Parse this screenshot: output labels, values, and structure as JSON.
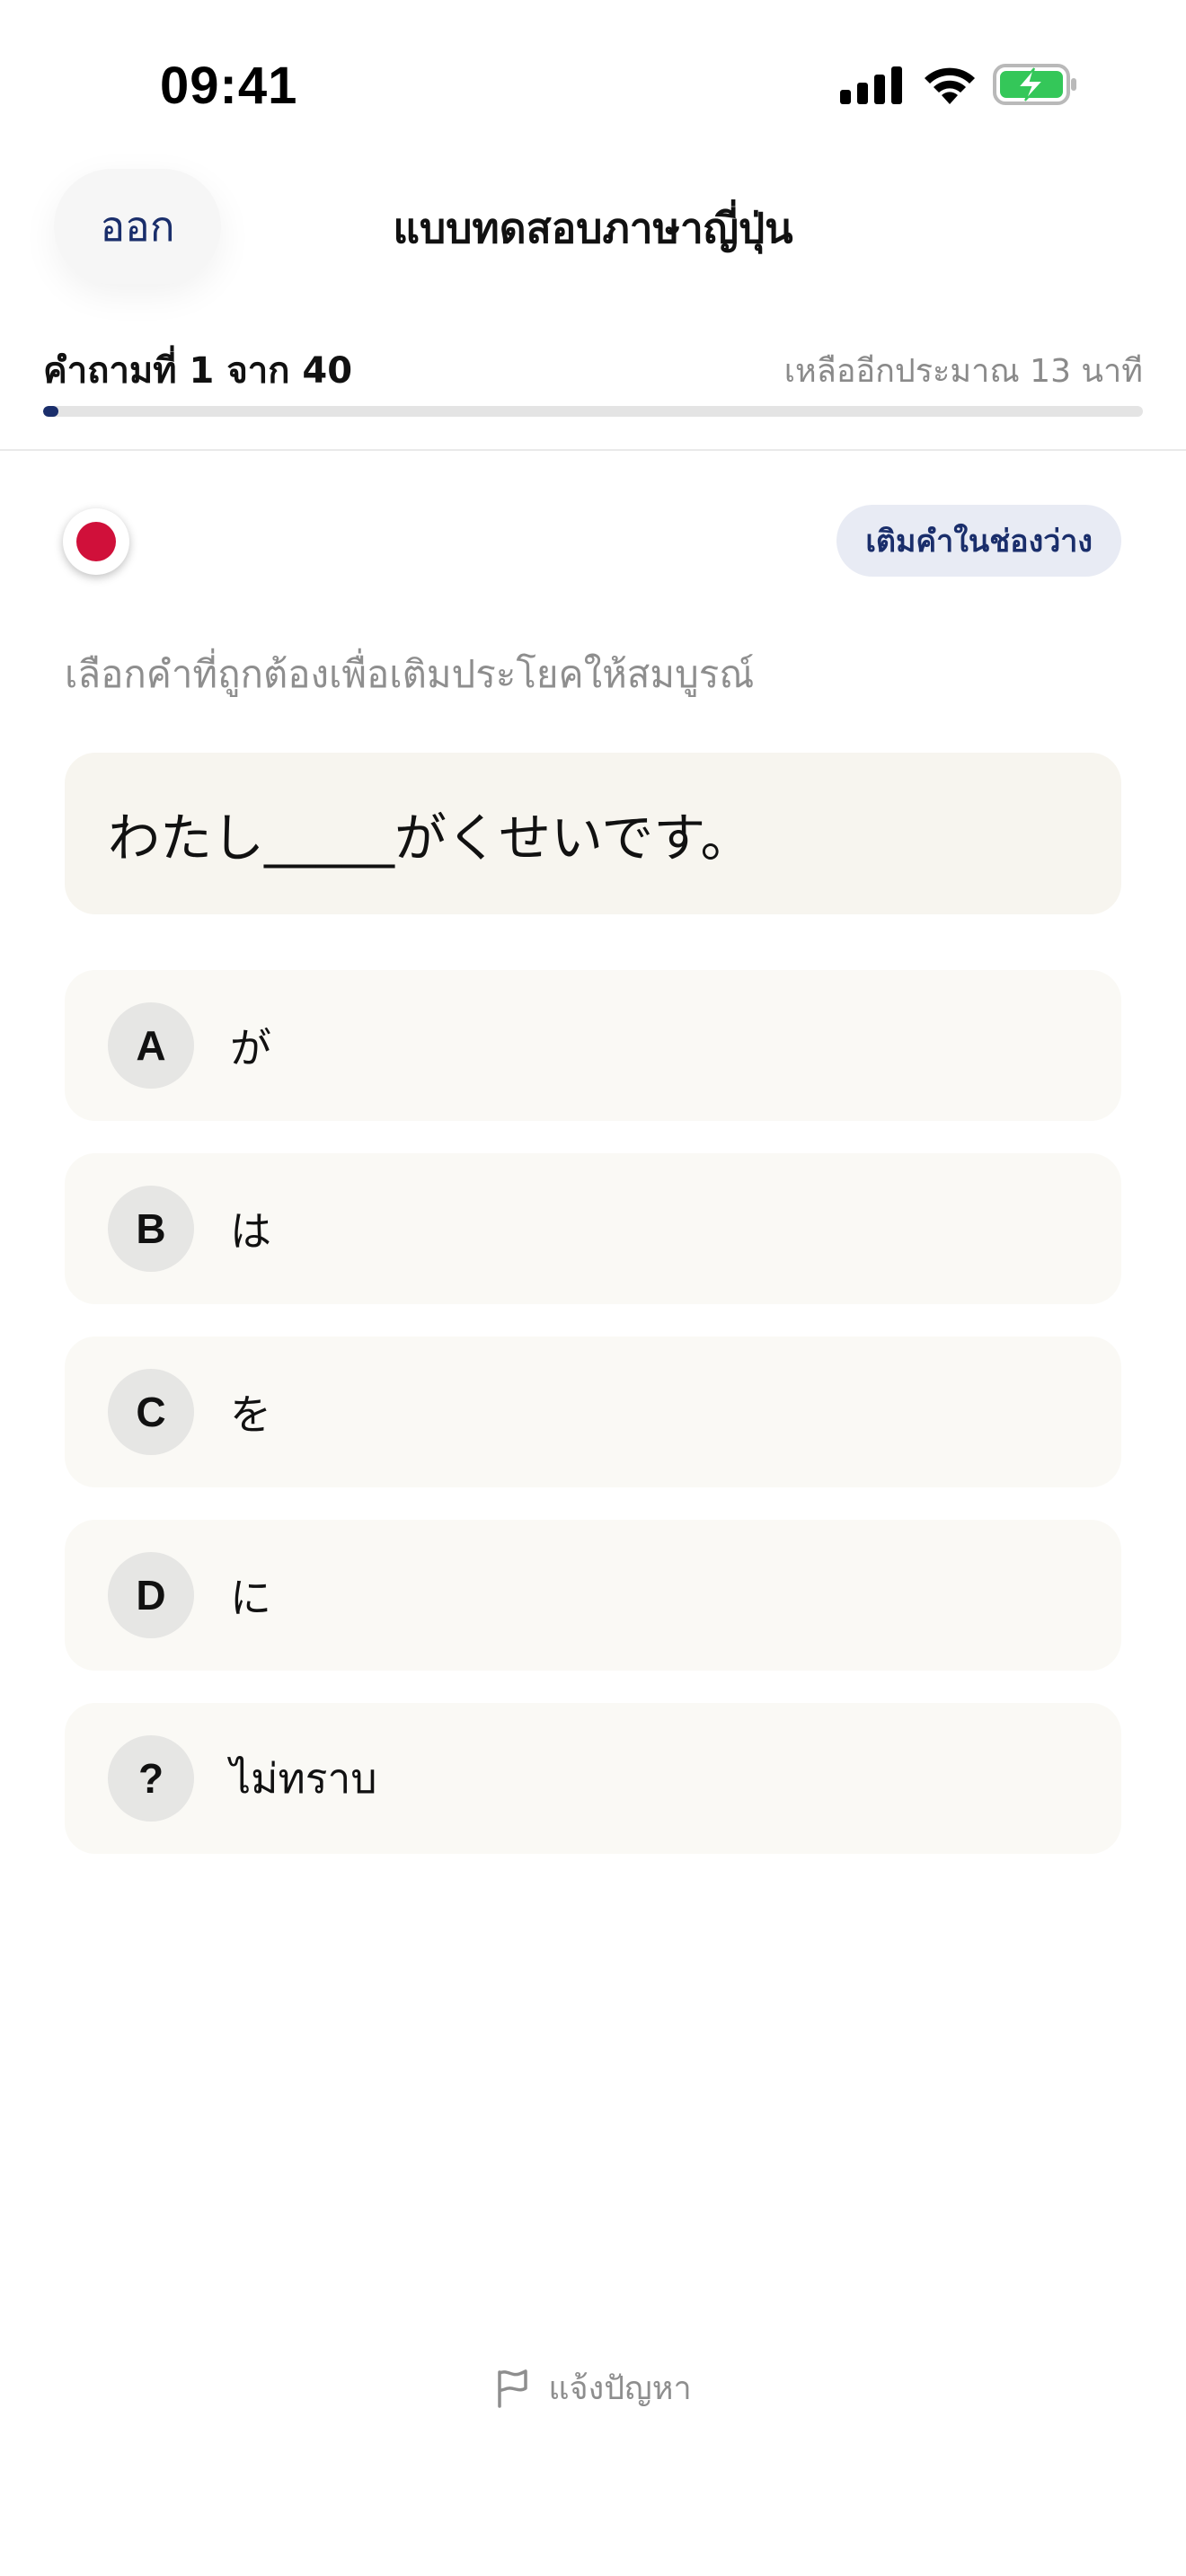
{
  "status_bar": {
    "time": "09:41",
    "icons": [
      "signal-icon",
      "wifi-icon",
      "battery-charging-icon"
    ],
    "battery_color": "#34c759"
  },
  "header": {
    "exit_label": "ออก",
    "title": "แบบทดสอบภาษาญี่ปุ่น"
  },
  "progress": {
    "label": "คำถามที่ 1 จาก 40",
    "time_remaining": "เหลืออีกประมาณ 13 นาที",
    "current": 1,
    "total": 40
  },
  "question": {
    "flag_icon": "japan-flag-icon",
    "type": "เติมคำในช่องว่าง",
    "instruction": "เลือกคำที่ถูกต้องเพื่อเติมประโยคให้สมบูรณ์",
    "sentence": "わたし_____がくせいです。"
  },
  "options": [
    {
      "key": "A",
      "text": "が"
    },
    {
      "key": "B",
      "text": "は"
    },
    {
      "key": "C",
      "text": "を"
    },
    {
      "key": "D",
      "text": "に"
    },
    {
      "key": "?",
      "text": "ไม่ทราบ"
    }
  ],
  "footer": {
    "report_label": "แจ้งปัญหา",
    "report_icon": "flag-icon"
  },
  "colors": {
    "accent": "#1a2e6b",
    "flag_red": "#d0103a",
    "card_bg": "#f7f5ef",
    "option_bg": "#faf9f5"
  }
}
